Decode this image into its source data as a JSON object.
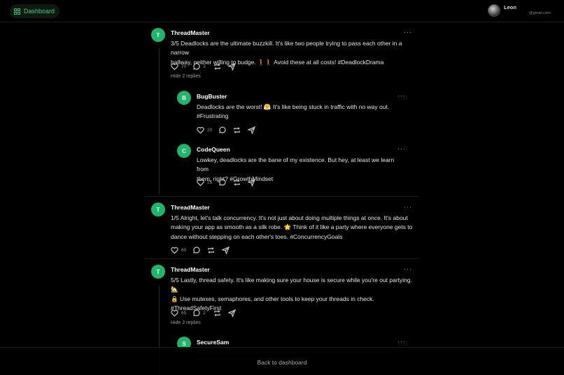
{
  "header": {
    "dashboard_label": "Dashboard",
    "user_name": "Leon",
    "user_email": "@gmail.com"
  },
  "posts": [
    {
      "avatar": "T",
      "author": "ThreadMaster",
      "menu": "···",
      "lines": [
        "3/5 Deadlocks are the ultimate buzzkill. It's like two people trying to pass each other in a narrow",
        "hallway, neither willing to budge. 🚶🚶 Avoid these at all costs! #DeadlockDrama"
      ],
      "likes": "70",
      "comments": "2",
      "hide_replies": "Hide 2 replies"
    },
    {
      "avatar": "B",
      "author": "BugBuster",
      "menu": "···",
      "lines": [
        "Deadlocks are the worst! 😤 It's like being stuck in traffic with no way out.",
        "#Frustrating"
      ],
      "likes": "20",
      "comments": ""
    },
    {
      "avatar": "C",
      "author": "CodeQueen",
      "menu": "···",
      "lines": [
        "Lowkey, deadlocks are the bane of my existence. But hey, at least we learn from",
        "them, right? #GrowthMindset"
      ],
      "likes": "25",
      "comments": ""
    },
    {
      "avatar": "T",
      "author": "ThreadMaster",
      "menu": "···",
      "lines": [
        "1/5 Alright, let's talk concurrency. It's not just about doing multiple things at once. It's about",
        "making your app as smooth as a silk robe. 🌟 Think of it like a party where everyone gets to",
        "dance without stepping on each other's toes. #ConcurrencyGoals"
      ],
      "likes": "60",
      "comments": ""
    },
    {
      "avatar": "T",
      "author": "ThreadMaster",
      "menu": "···",
      "lines": [
        "5/5 Lastly, thread safety. It's like making sure your house is secure while you're out partying. 🏡",
        "🔒 Use mutexes, semaphores, and other tools to keep your threads in check.",
        "#ThreadSafetyFirst"
      ],
      "likes": "65",
      "comments": "2",
      "hide_replies": "Hide 2 replies"
    },
    {
      "avatar": "S",
      "author": "SecureSam",
      "menu": "···",
      "lines": []
    }
  ],
  "footer": {
    "back_label": "Back to dashboard"
  },
  "icons": {
    "dashboard": "grid-icon",
    "like": "heart-icon",
    "comment": "comment-icon",
    "repost": "repost-icon",
    "share": "send-icon"
  },
  "colors": {
    "accent": "#1fb56a",
    "background": "#000000"
  }
}
